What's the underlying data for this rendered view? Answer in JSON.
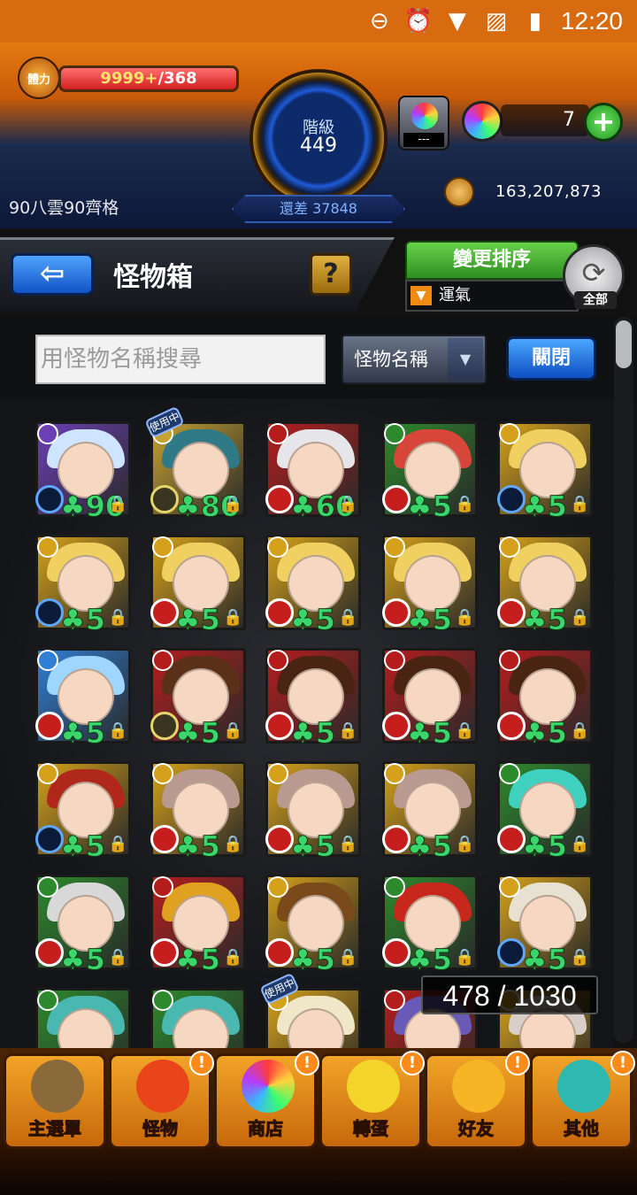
{
  "status_bar": {
    "time": "12:20"
  },
  "header": {
    "stamina_label": "體力",
    "stamina_current": "9999+",
    "stamina_max": "/368",
    "rank_label": "階級",
    "rank_value": "449",
    "remain_text": "還差 37848",
    "username": "90八雲90齊格",
    "orb_box_label": "---",
    "orb_count": "7",
    "gold": "163,207,873"
  },
  "page": {
    "title": "怪物箱",
    "help_label": "?",
    "sort_button": "變更排序",
    "sort_value": "運氣",
    "all_label": "全部"
  },
  "search": {
    "placeholder": "用怪物名稱搜尋",
    "mode": "怪物名稱",
    "close_label": "關閉"
  },
  "grid": {
    "rows": [
      [
        {
          "lvl": "90",
          "inuse": false
        },
        {
          "lvl": "80",
          "inuse": true
        },
        {
          "lvl": "60",
          "inuse": false
        },
        {
          "lvl": "5",
          "inuse": false
        },
        {
          "lvl": "5",
          "inuse": false
        }
      ],
      [
        {
          "lvl": "5",
          "inuse": false
        },
        {
          "lvl": "5",
          "inuse": false
        },
        {
          "lvl": "5",
          "inuse": false
        },
        {
          "lvl": "5",
          "inuse": false
        },
        {
          "lvl": "5",
          "inuse": false
        }
      ],
      [
        {
          "lvl": "5",
          "inuse": false
        },
        {
          "lvl": "5",
          "inuse": false
        },
        {
          "lvl": "5",
          "inuse": false
        },
        {
          "lvl": "5",
          "inuse": false
        },
        {
          "lvl": "5",
          "inuse": false
        }
      ],
      [
        {
          "lvl": "5",
          "inuse": false
        },
        {
          "lvl": "5",
          "inuse": false
        },
        {
          "lvl": "5",
          "inuse": false
        },
        {
          "lvl": "5",
          "inuse": false
        },
        {
          "lvl": "5",
          "inuse": false
        }
      ],
      [
        {
          "lvl": "5",
          "inuse": false
        },
        {
          "lvl": "5",
          "inuse": false
        },
        {
          "lvl": "5",
          "inuse": false
        },
        {
          "lvl": "5",
          "inuse": false
        },
        {
          "lvl": "5",
          "inuse": false
        }
      ],
      [
        {
          "lvl": "",
          "inuse": false
        },
        {
          "lvl": "",
          "inuse": false
        },
        {
          "lvl": "",
          "inuse": true
        },
        {
          "lvl": "",
          "inuse": false
        },
        {
          "lvl": "",
          "inuse": false
        }
      ]
    ],
    "in_use_label": "使用中",
    "count": "478 / 1030"
  },
  "nav": {
    "items": [
      {
        "label": "主選單",
        "badge": ""
      },
      {
        "label": "怪物",
        "badge": "!"
      },
      {
        "label": "商店",
        "badge": "!"
      },
      {
        "label": "轉蛋",
        "badge": "!"
      },
      {
        "label": "好友",
        "badge": "!"
      },
      {
        "label": "其他",
        "badge": "!"
      }
    ]
  },
  "colors": {
    "accent": "#e57a12",
    "grid_bg": "#1b1c20",
    "level_green": "#3bd66b"
  }
}
